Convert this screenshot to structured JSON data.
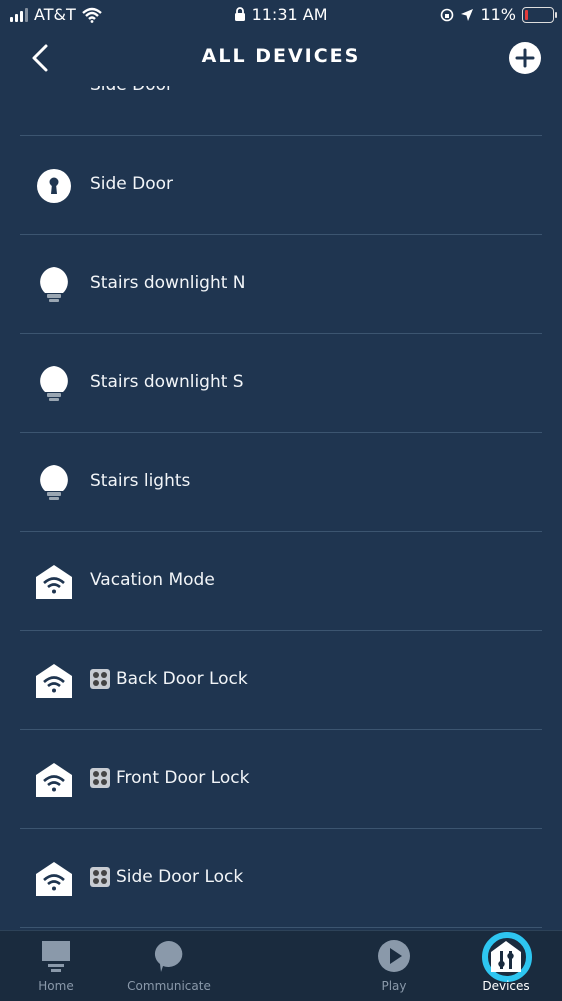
{
  "status": {
    "carrier": "AT&T",
    "time": "11:31 AM",
    "battery": "11%",
    "battery_level": 0.11
  },
  "header": {
    "title": "ALL DEVICES"
  },
  "devices": [
    {
      "label": "Side Door",
      "icon": "camera-icon"
    },
    {
      "label": "Side Door",
      "icon": "keyhole-lock-icon"
    },
    {
      "label": "Stairs downlight N",
      "icon": "bulb-icon"
    },
    {
      "label": "Stairs downlight S",
      "icon": "bulb-icon"
    },
    {
      "label": "Stairs lights",
      "icon": "bulb-icon"
    },
    {
      "label": "Vacation Mode",
      "icon": "smart-home-icon"
    },
    {
      "label": "Back Door Lock",
      "icon": "smart-home-icon",
      "badge": "sensor-badge-icon"
    },
    {
      "label": "Front Door Lock",
      "icon": "smart-home-icon",
      "badge": "sensor-badge-icon"
    },
    {
      "label": "Side Door Lock",
      "icon": "smart-home-icon",
      "badge": "sensor-badge-icon"
    }
  ],
  "tabs": [
    {
      "label": "Home",
      "icon": "home-icon"
    },
    {
      "label": "Communicate",
      "icon": "chat-bubble-icon"
    },
    {
      "label": "",
      "icon": "alexa-ring-icon"
    },
    {
      "label": "Play",
      "icon": "play-icon"
    },
    {
      "label": "Devices",
      "icon": "devices-icon"
    }
  ],
  "colors": {
    "background": "#1f3550",
    "tabbar": "#1a2b3e",
    "alexa_accent": "#2ec6f1",
    "battery_low": "#e23b3b"
  }
}
